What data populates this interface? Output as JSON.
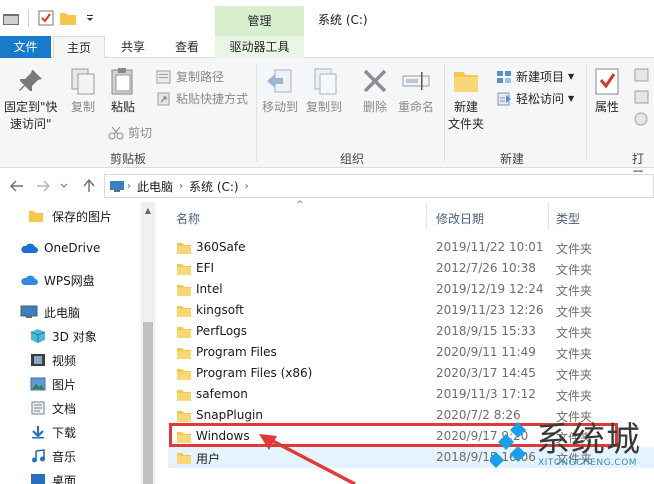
{
  "title_bar": {
    "manage_tab": "管理",
    "window_title": "系统 (C:)"
  },
  "tabs": {
    "file": "文件",
    "home": "主页",
    "share": "共享",
    "view": "查看",
    "drive_tools": "驱动器工具"
  },
  "ribbon": {
    "clipboard": {
      "pin_line1": "固定到\"快",
      "pin_line2": "速访问\"",
      "copy": "复制",
      "paste": "粘贴",
      "copy_path": "复制路径",
      "paste_shortcut": "粘贴快捷方式",
      "cut": "剪切",
      "label": "剪贴板"
    },
    "organize": {
      "move_to": "移动到",
      "copy_to": "复制到",
      "delete": "删除",
      "rename": "重命名",
      "label": "组织"
    },
    "new": {
      "new_folder_line1": "新建",
      "new_folder_line2": "文件夹",
      "new_item": "新建项目",
      "easy_access": "轻松访问",
      "label": "新建"
    },
    "open": {
      "properties": "属性",
      "label": "打开"
    }
  },
  "address": {
    "crumbs": [
      "此电脑",
      "系统 (C:)"
    ]
  },
  "nav_pane": {
    "items": [
      {
        "label": "保存的图片",
        "icon": "folder-icon"
      },
      {
        "label": "OneDrive",
        "icon": "cloud-icon"
      },
      {
        "label": "WPS网盘",
        "icon": "cloud-icon"
      },
      {
        "label": "此电脑",
        "icon": "computer-icon"
      },
      {
        "label": "3D 对象",
        "icon": "cube-icon"
      },
      {
        "label": "视频",
        "icon": "video-icon"
      },
      {
        "label": "图片",
        "icon": "picture-icon"
      },
      {
        "label": "文档",
        "icon": "document-icon"
      },
      {
        "label": "下载",
        "icon": "download-icon"
      },
      {
        "label": "音乐",
        "icon": "music-icon"
      },
      {
        "label": "桌面",
        "icon": "desktop-icon"
      }
    ]
  },
  "file_list": {
    "columns": {
      "name": "名称",
      "modified": "修改日期",
      "type": "类型"
    },
    "rows": [
      {
        "name": "360Safe",
        "date": "2019/11/22 10:01",
        "type": "文件夹"
      },
      {
        "name": "EFI",
        "date": "2012/7/26 10:38",
        "type": "文件夹"
      },
      {
        "name": "Intel",
        "date": "2019/12/19 12:24",
        "type": "文件夹"
      },
      {
        "name": "kingsoft",
        "date": "2019/11/23 12:26",
        "type": "文件夹"
      },
      {
        "name": "PerfLogs",
        "date": "2018/9/15 15:33",
        "type": "文件夹"
      },
      {
        "name": "Program Files",
        "date": "2020/9/11 11:49",
        "type": "文件夹"
      },
      {
        "name": "Program Files (x86)",
        "date": "2020/3/17 14:45",
        "type": "文件夹"
      },
      {
        "name": "safemon",
        "date": "2019/11/3 17:12",
        "type": "文件夹"
      },
      {
        "name": "SnapPlugin",
        "date": "2020/7/2 8:26",
        "type": "文件夹"
      },
      {
        "name": "Windows",
        "date": "2020/9/17 9:20",
        "type": "文件夹"
      },
      {
        "name": "用户",
        "date": "2018/9/15 16:06",
        "type": "文件夹"
      }
    ]
  },
  "watermark": {
    "text": "系统城",
    "sub": "XITONGCHENG.COM"
  },
  "colors": {
    "file_tab": "#1979ca",
    "manage_tab": "#d8efd0",
    "highlight": "#e0393a",
    "folder": "#f5c84c"
  }
}
